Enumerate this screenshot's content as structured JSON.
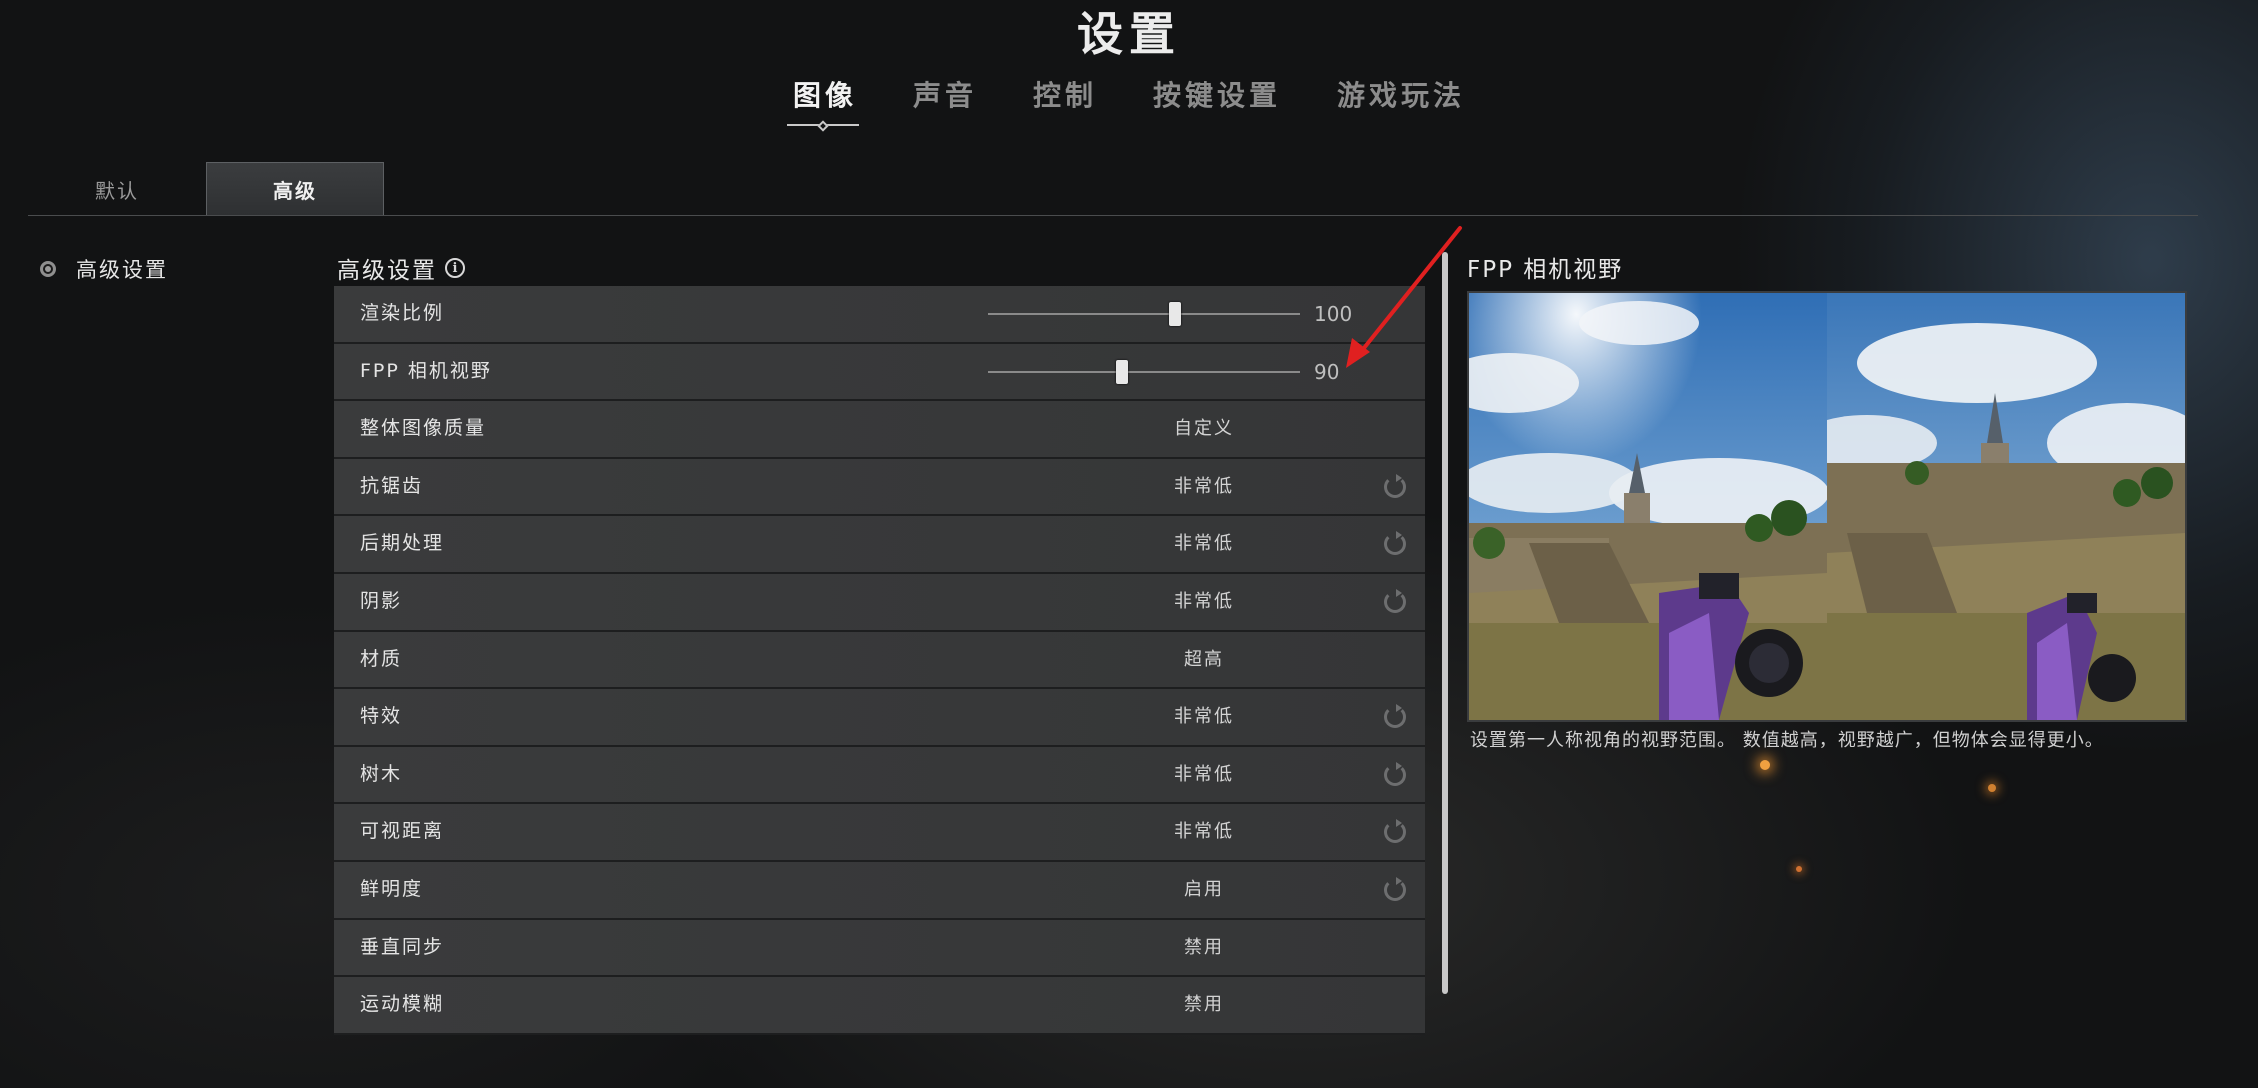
{
  "title": "设置",
  "tabs": [
    {
      "label": "图像",
      "active": true
    },
    {
      "label": "声音",
      "active": false
    },
    {
      "label": "控制",
      "active": false
    },
    {
      "label": "按键设置",
      "active": false
    },
    {
      "label": "游戏玩法",
      "active": false
    }
  ],
  "subtabs": [
    {
      "label": "默认",
      "active": false
    },
    {
      "label": "高级",
      "active": true
    }
  ],
  "sidebar": {
    "items": [
      {
        "label": "高级设置",
        "selected": true
      }
    ]
  },
  "panel": {
    "heading": "高级设置",
    "info_icon": "info-icon",
    "rows": [
      {
        "label": "渲染比例",
        "type": "slider",
        "value": "100",
        "fraction": 0.6
      },
      {
        "label": "FPP 相机视野",
        "type": "slider",
        "value": "90",
        "fraction": 0.43
      },
      {
        "label": "整体图像质量",
        "type": "option",
        "value": "自定义",
        "reset": false
      },
      {
        "label": "抗锯齿",
        "type": "option",
        "value": "非常低",
        "reset": true
      },
      {
        "label": "后期处理",
        "type": "option",
        "value": "非常低",
        "reset": true
      },
      {
        "label": "阴影",
        "type": "option",
        "value": "非常低",
        "reset": true
      },
      {
        "label": "材质",
        "type": "option",
        "value": "超高",
        "reset": false
      },
      {
        "label": "特效",
        "type": "option",
        "value": "非常低",
        "reset": true
      },
      {
        "label": "树木",
        "type": "option",
        "value": "非常低",
        "reset": true
      },
      {
        "label": "可视距离",
        "type": "option",
        "value": "非常低",
        "reset": true
      },
      {
        "label": "鲜明度",
        "type": "option",
        "value": "启用",
        "reset": true
      },
      {
        "label": "垂直同步",
        "type": "option",
        "value": "禁用",
        "reset": false
      },
      {
        "label": "运动模糊",
        "type": "option",
        "value": "禁用",
        "reset": false
      }
    ]
  },
  "preview": {
    "title": "FPP 相机视野",
    "description": "设置第一人称视角的视野范围。 数值越高，视野越广，但物体会显得更小。"
  },
  "colors": {
    "accent": "#e6e6e6",
    "arrow": "#e02020",
    "row_bg": "#383939"
  }
}
